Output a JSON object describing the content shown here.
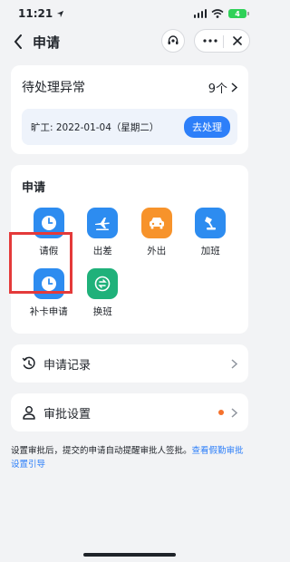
{
  "status_bar": {
    "time": "11:21",
    "battery": "4"
  },
  "nav": {
    "title": "申请"
  },
  "pending": {
    "title": "待处理异常",
    "count": "9个",
    "absence_text": "旷工: 2022-01-04（星期二）",
    "process_label": "去处理"
  },
  "apply": {
    "title": "申请",
    "items": [
      {
        "label": "请假",
        "icon": "clock-icon",
        "color": "#2d8cf0"
      },
      {
        "label": "出差",
        "icon": "airplane-icon",
        "color": "#2d8cf0"
      },
      {
        "label": "外出",
        "icon": "car-icon",
        "color": "#f7932b"
      },
      {
        "label": "加班",
        "icon": "desk-lamp-icon",
        "color": "#2d8cf0"
      },
      {
        "label": "补卡申请",
        "icon": "clock-icon",
        "color": "#2d8cf0"
      },
      {
        "label": "换班",
        "icon": "swap-icon",
        "color": "#1fb17a"
      }
    ]
  },
  "records": {
    "label": "申请记录"
  },
  "approval_settings": {
    "label": "审批设置"
  },
  "footer": {
    "text": "设置审批后，提交的申请自动提醒审批人签批。",
    "link": "查看假勤审批设置引导"
  }
}
